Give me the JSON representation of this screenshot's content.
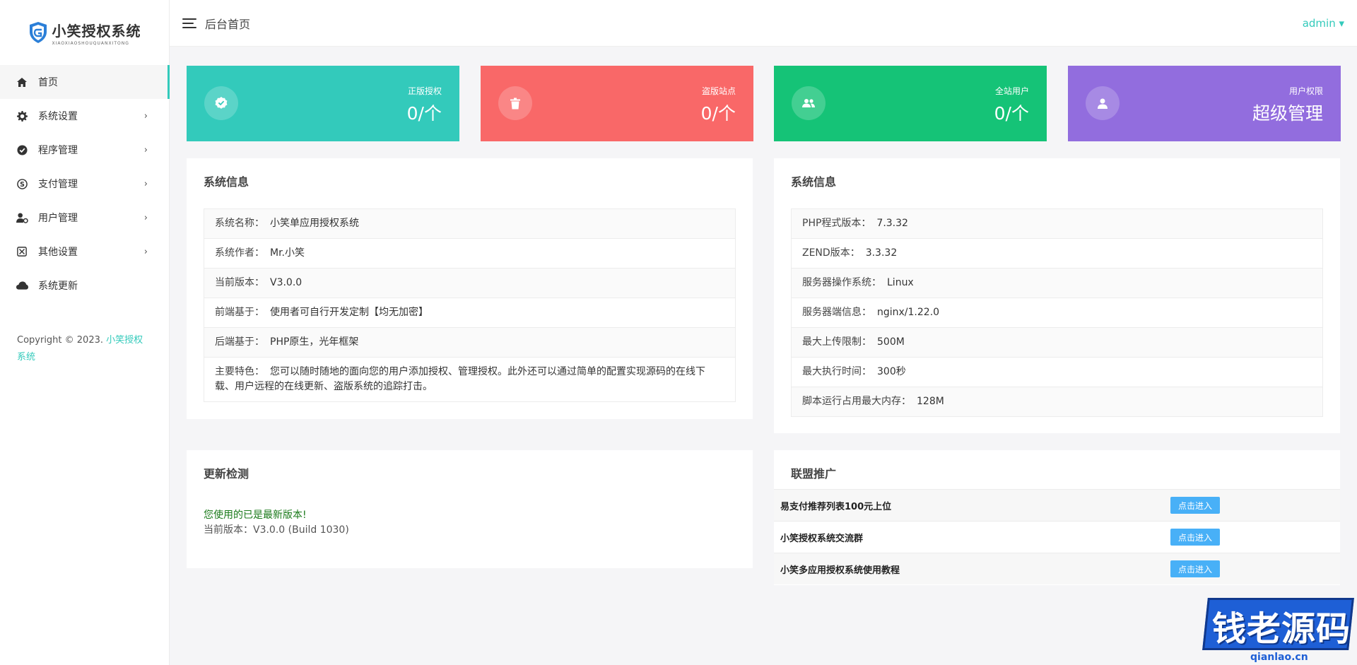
{
  "app": {
    "logo_title": "小笑授权系统",
    "logo_sub": "XIAOXIAOSHOUQUANXITONG"
  },
  "sidebar": {
    "items": [
      {
        "label": "首页",
        "icon": "home-icon",
        "has_arrow": false,
        "active": true
      },
      {
        "label": "系统设置",
        "icon": "gear-icon",
        "has_arrow": true
      },
      {
        "label": "程序管理",
        "icon": "badge-check-icon",
        "has_arrow": true
      },
      {
        "label": "支付管理",
        "icon": "skype-icon",
        "has_arrow": true
      },
      {
        "label": "用户管理",
        "icon": "user-gear-icon",
        "has_arrow": true
      },
      {
        "label": "其他设置",
        "icon": "cross-box-icon",
        "has_arrow": true
      },
      {
        "label": "系统更新",
        "icon": "cloud-icon",
        "has_arrow": false
      }
    ],
    "arrow": "›",
    "copyright_prefix": "Copyright © 2023.",
    "copyright_brand": "小笑授权系统"
  },
  "header": {
    "title": "后台首页",
    "user": "admin ▾"
  },
  "cards": [
    {
      "label": "正版授权",
      "value": "0/个",
      "color": "#33cabb",
      "icon": "check-badge-icon"
    },
    {
      "label": "盗版站点",
      "value": "0/个",
      "color": "#f96868",
      "icon": "trash-icon"
    },
    {
      "label": "全站用户",
      "value": "0/个",
      "color": "#15c377",
      "icon": "users-icon"
    },
    {
      "label": "用户权限",
      "value": "超级管理",
      "color": "#926dde",
      "icon": "user-icon"
    }
  ],
  "sysinfo_left": {
    "title": "系统信息",
    "rows": [
      {
        "k": "系统名称：",
        "v": "小笑单应用授权系统"
      },
      {
        "k": "系统作者：",
        "v": "Mr.小笑"
      },
      {
        "k": "当前版本：",
        "v": "V3.0.0"
      },
      {
        "k": "前端基于：",
        "v": "使用者可自行开发定制【均无加密】"
      },
      {
        "k": "后端基于：",
        "v": "PHP原生，光年框架"
      },
      {
        "k": "主要特色：",
        "v": "您可以随时随地的面向您的用户添加授权、管理授权。此外还可以通过简单的配置实现源码的在线下载、用户远程的在线更新、盗版系统的追踪打击。"
      }
    ]
  },
  "sysinfo_right": {
    "title": "系统信息",
    "rows": [
      {
        "k": "PHP程式版本：",
        "v": "7.3.32"
      },
      {
        "k": "ZEND版本：",
        "v": "3.3.32"
      },
      {
        "k": "服务器操作系统：",
        "v": "Linux"
      },
      {
        "k": "服务器端信息：",
        "v": "nginx/1.22.0"
      },
      {
        "k": "最大上传限制：",
        "v": "500M"
      },
      {
        "k": "最大执行时间：",
        "v": "300秒"
      },
      {
        "k": "脚本运行占用最大内存：",
        "v": "128M"
      }
    ]
  },
  "update": {
    "title": "更新检测",
    "status": "您使用的已是最新版本!",
    "version": "当前版本：V3.0.0 (Build 1030)"
  },
  "alliance": {
    "title": "联盟推广",
    "rows": [
      {
        "name": "易支付推荐列表100元上位",
        "button": "点击进入"
      },
      {
        "name": "小笑授权系统交流群",
        "button": "点击进入"
      },
      {
        "name": "小笑多应用授权系统使用教程",
        "button": "点击进入"
      }
    ]
  },
  "watermark": {
    "text": "钱老源码",
    "domain": "qianlao.cn"
  }
}
